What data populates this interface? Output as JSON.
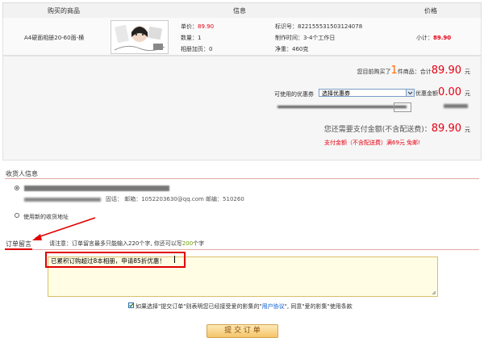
{
  "header": {
    "col_product": "购买的商品",
    "col_info": "信息",
    "col_price": "价格"
  },
  "product": {
    "name": "A4硬面相册20-60面-横",
    "unit_price_label": "单价：",
    "unit_price": "89.90",
    "quantity_label": "数量：1",
    "addon_label": "相册加页：0",
    "sku_label": "标识号：822155531503124078",
    "production_label": "制作时间：3-4个工作日",
    "weight_label": "净重：460克",
    "subtotal_label": "小计：",
    "subtotal": "89.90"
  },
  "summary": {
    "bought_prefix": "您目前购买了",
    "item_count": "1",
    "bought_suffix": "件商品：合计",
    "total": "89.90",
    "yuan": "元",
    "coupon_label": "可使用的优惠券",
    "coupon_select": "选择优惠券",
    "discount_label": "优惠金额",
    "discount": "0.00",
    "payable_label": "您还需要支付金额(不含配送费)：",
    "payable": "89.90",
    "shipping_note": "支付金额（不含配送费）满69元  免邮!"
  },
  "receiver": {
    "section_title": "收货人信息",
    "address_blurred": "广东省深圳市福田区某某街道某某号",
    "address_detail": "固话：  邮箱：1052203630@qq.com  邮编：510260",
    "new_address": "使用新的收货地址"
  },
  "message": {
    "section_title": "订单留言",
    "notice_prefix": "请注意：订单留言最多只能输入220个字, 你还可以写",
    "remaining": "200",
    "notice_suffix": "个字",
    "text": "已累积订购超过8本相册，申请85折优惠！"
  },
  "agreement": {
    "prefix": "如果选择\"提交订单\"则表明您已经接受爱的影集的\"",
    "link": "用户协议",
    "suffix": "\", 同意\"爱的影集\"使用条款"
  },
  "submit_label": "提 交 订 单",
  "colors": {
    "price_red": "#e60012",
    "count_orange": "#ff6a00",
    "annotation_red": "#e00000",
    "link_blue": "#0055cc"
  }
}
